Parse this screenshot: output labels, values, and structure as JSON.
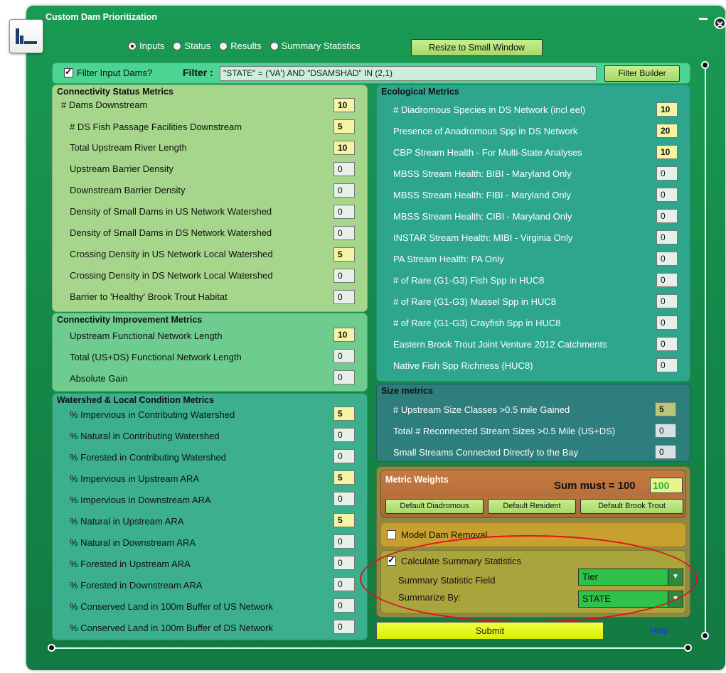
{
  "window": {
    "title": "Custom Dam Prioritization",
    "close_glyph": "✕"
  },
  "tabs": [
    {
      "label": "Inputs",
      "selected": true
    },
    {
      "label": "Status",
      "selected": false
    },
    {
      "label": "Results",
      "selected": false
    },
    {
      "label": "Summary Statistics",
      "selected": false
    }
  ],
  "resize_button": "Resize to Small Window",
  "filter": {
    "checkbox_label": "Filter Input Dams?",
    "label": "Filter :",
    "value": "\"STATE\" = ('VA') AND \"DSAMSHAD\" IN (2,1)",
    "builder_button": "Filter Builder"
  },
  "connectivity_status": {
    "title": "Connectivity Status Metrics",
    "rows": [
      {
        "label": "# Dams Downstream",
        "value": "10"
      },
      {
        "label": "# DS Fish Passage Facilities Downstream",
        "value": "5"
      },
      {
        "label": "Total Upstream River Length",
        "value": "10"
      },
      {
        "label": "Upstream Barrier Density",
        "value": "0"
      },
      {
        "label": "Downstream Barrier Density",
        "value": "0"
      },
      {
        "label": "Density of Small Dams in US Network Watershed",
        "value": "0"
      },
      {
        "label": "Density of Small Dams in DS Network Watershed",
        "value": "0"
      },
      {
        "label": "Crossing Density in US Network Local Watershed",
        "value": "5"
      },
      {
        "label": "Crossing Density in DS Network Local Watershed",
        "value": "0"
      },
      {
        "label": "Barrier to 'Healthy' Brook Trout Habitat",
        "value": "0"
      }
    ]
  },
  "connectivity_improvement": {
    "title": "Connectivity Improvement Metrics",
    "rows": [
      {
        "label": "Upstream Functional Network Length",
        "value": "10"
      },
      {
        "label": "Total (US+DS) Functional Network Length",
        "value": "0"
      },
      {
        "label": "Absolute Gain",
        "value": "0"
      }
    ]
  },
  "watershed": {
    "title": "Watershed & Local Condition Metrics",
    "rows": [
      {
        "label": "% Impervious in Contributing Watershed",
        "value": "5"
      },
      {
        "label": "% Natural in Contributing Watershed",
        "value": "0"
      },
      {
        "label": "% Forested in Contributing Watershed",
        "value": "0"
      },
      {
        "label": "% Impervious in Upstream ARA",
        "value": "5"
      },
      {
        "label": "% Impervious in Downstream ARA",
        "value": "0"
      },
      {
        "label": "% Natural in Upstream ARA",
        "value": "5"
      },
      {
        "label": "% Natural in Downstream ARA",
        "value": "0"
      },
      {
        "label": "% Forested in Upstream ARA",
        "value": "0"
      },
      {
        "label": "% Forested in Downstream ARA",
        "value": "0"
      },
      {
        "label": "% Conserved Land in 100m Buffer of US Network",
        "value": "0"
      },
      {
        "label": "% Conserved Land in 100m Buffer of DS Network",
        "value": "0"
      }
    ]
  },
  "ecological": {
    "title": "Ecological Metrics",
    "rows": [
      {
        "label": "# Diadromous Species in DS Network (incl eel)",
        "value": "10"
      },
      {
        "label": "Presence of Anadromous Spp in DS Network",
        "value": "20"
      },
      {
        "label": "CBP Stream Health - For Multi-State Analyses",
        "value": "10"
      },
      {
        "label": "MBSS Stream Health: BIBI - Maryland Only",
        "value": "0"
      },
      {
        "label": "MBSS Stream Health: FIBI - Maryland Only",
        "value": "0"
      },
      {
        "label": "MBSS Stream Health: CIBI - Maryland Only",
        "value": "0"
      },
      {
        "label": "INSTAR Stream Health: MIBI - Virginia Only",
        "value": "0"
      },
      {
        "label": "PA Stream Health: PA Only",
        "value": "0"
      },
      {
        "label": "# of Rare (G1-G3) Fish Spp in HUC8",
        "value": "0"
      },
      {
        "label": "# of Rare (G1-G3) Mussel Spp in HUC8",
        "value": "0"
      },
      {
        "label": "# of Rare (G1-G3) Crayfish Spp in HUC8",
        "value": "0"
      },
      {
        "label": "Eastern Brook Trout Joint Venture 2012 Catchments",
        "value": "0"
      },
      {
        "label": "Native Fish Spp Richness (HUC8)",
        "value": "0"
      }
    ]
  },
  "size": {
    "title": "Size metrics",
    "rows": [
      {
        "label": "# Upstream Size Classes >0.5 mile Gained",
        "value": "5"
      },
      {
        "label": "Total # Reconnected Stream Sizes >0.5 Mile (US+DS)",
        "value": "0"
      },
      {
        "label": "Small Streams Connected Directly to the Bay",
        "value": "0"
      }
    ]
  },
  "weights": {
    "title": "Metric Weights",
    "sum_label": "Sum must = 100",
    "sum_value": "100",
    "buttons": [
      "Default Diadromous",
      "Default Resident",
      "Default Brook Trout"
    ]
  },
  "model_dam_removal": {
    "label": "Model Dam Removal",
    "checked": false
  },
  "summary": {
    "checkbox_label": "Calculate Summary Statistics",
    "field_label": "Summary Statistic Field",
    "field_value": "Tier",
    "by_label": "Summarize By:",
    "by_value": "STATE"
  },
  "submit": "Submit",
  "help": "Help",
  "colors": {
    "window_green": "#158a4a",
    "highlight_value": "#f3f5a5",
    "annotation_red": "#e01020",
    "submit_yellow": "#e0f600"
  }
}
